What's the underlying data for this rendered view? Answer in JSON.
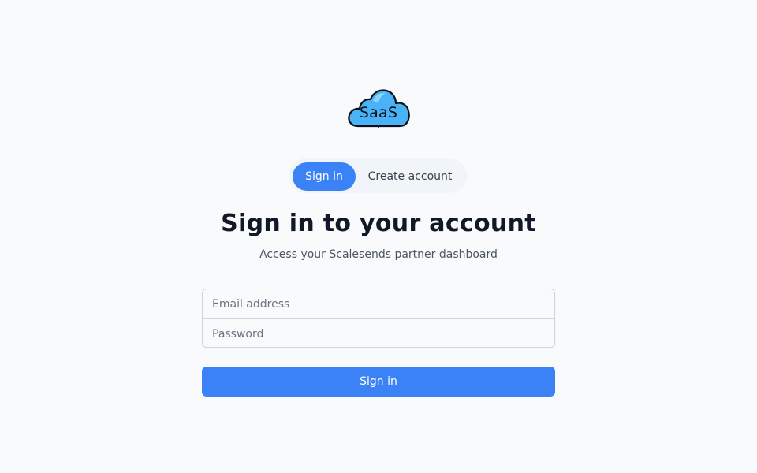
{
  "logo": {
    "text": "SaaS",
    "icon": "cloud-logo-icon",
    "colors": {
      "fill": "#4ab3f7",
      "highlight": "#7ec8fb",
      "outline": "#0b0f19"
    }
  },
  "tabs": [
    {
      "label": "Sign in",
      "active": true
    },
    {
      "label": "Create account",
      "active": false
    }
  ],
  "heading": {
    "title": "Sign in to your account",
    "subtitle": "Access your Scalesends partner dashboard"
  },
  "form": {
    "email": {
      "placeholder": "Email address",
      "value": ""
    },
    "password": {
      "placeholder": "Password",
      "value": ""
    },
    "submit_label": "Sign in"
  },
  "colors": {
    "accent": "#3b82f6",
    "background": "#f8fafc",
    "text": "#111827"
  }
}
